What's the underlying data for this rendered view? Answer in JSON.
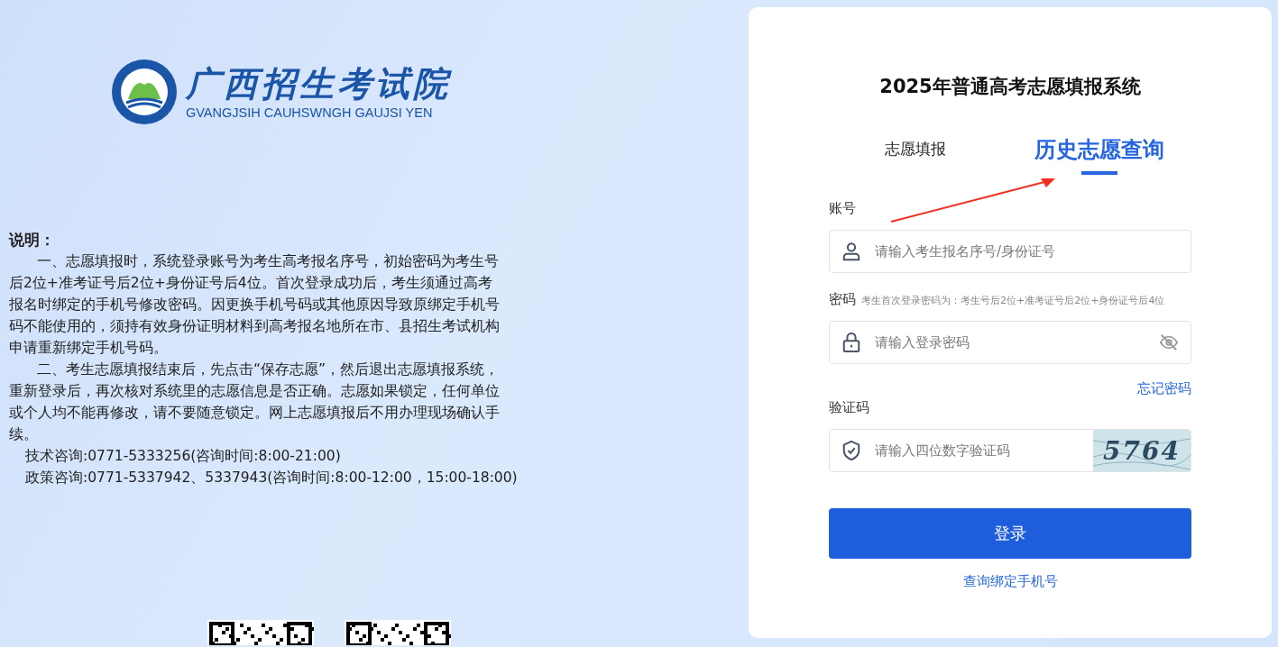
{
  "logo": {
    "title": "广西招生考试院",
    "subtitle": "GVANGJSIH CAUHSWNGH GAUJSI YEN"
  },
  "notice": {
    "heading": "说明：",
    "paragraphs": [
      "一、志愿填报时，系统登录账号为考生高考报名序号，初始密码为考生号后2位+准考证号后2位+身份证号后4位。首次登录成功后，考生须通过高考报名时绑定的手机号修改密码。因更换手机号码或其他原因导致原绑定手机号码不能使用的，须持有效身份证明材料到高考报名地所在市、县招生考试机构申请重新绑定手机号码。",
      "二、考生志愿填报结束后，先点击“保存志愿”，然后退出志愿填报系统，重新登录后，再次核对系统里的志愿信息是否正确。志愿如果锁定，任何单位或个人均不能再修改，请不要随意锁定。网上志愿填报后不用办理现场确认手续。"
    ],
    "contacts": [
      "技术咨询:0771-5333256(咨询时间:8:00-21:00)",
      "政策咨询:0771-5337942、5337943(咨询时间:8:00-12:00，15:00-18:00)"
    ]
  },
  "login": {
    "title": "2025年普通高考志愿填报系统",
    "tabs": [
      {
        "label": "志愿填报",
        "selected": false
      },
      {
        "label": "历史志愿查询",
        "selected": true
      }
    ],
    "account": {
      "label": "账号",
      "placeholder": "请输入考生报名序号/身份证号"
    },
    "password": {
      "label": "密码",
      "hint": "考生首次登录密码为：考生号后2位+准考证号后2位+身份证号后4位",
      "placeholder": "请输入登录密码"
    },
    "forgot_link": "忘记密码",
    "captcha": {
      "label": "验证码",
      "placeholder": "请输入四位数字验证码",
      "code": "5764"
    },
    "login_button": "登录",
    "phone_link": "查询绑定手机号"
  }
}
